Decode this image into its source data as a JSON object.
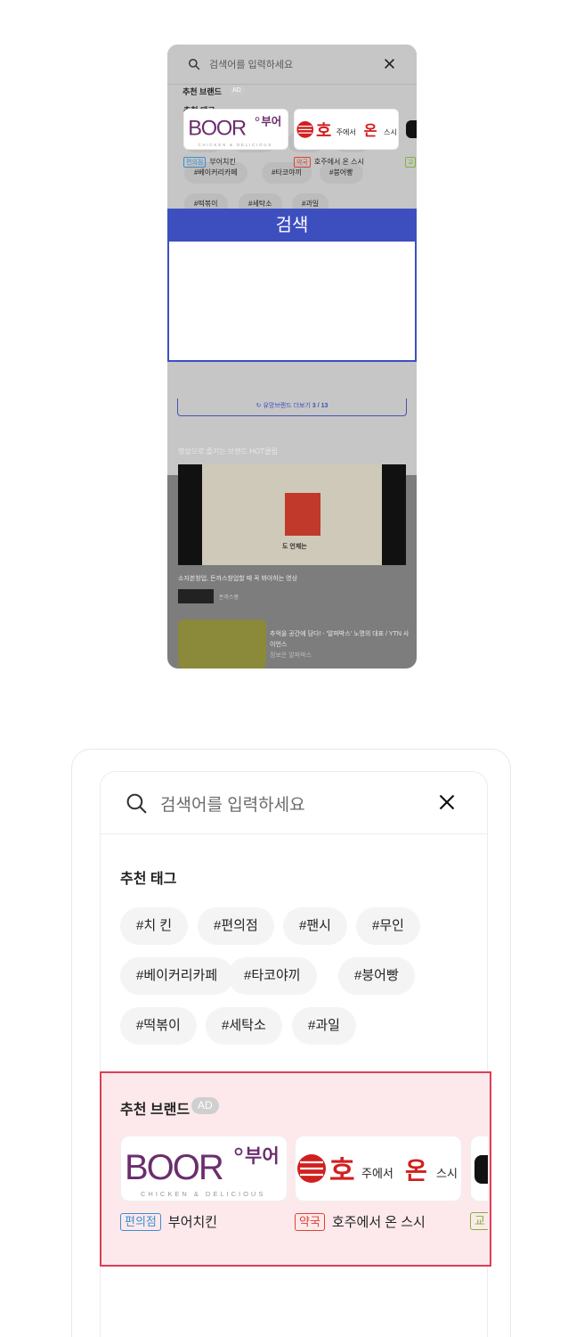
{
  "search": {
    "placeholder": "검색어를 입력하세요"
  },
  "tags": {
    "title": "추천 태그",
    "items": [
      "#치 킨",
      "#편의점",
      "#팬시",
      "#무인",
      "#베이커리카페",
      "#타코야끼",
      "#붕어빵",
      "#떡볶이",
      "#세탁소",
      "#과일"
    ]
  },
  "overlay": {
    "search_button": "검색"
  },
  "brands": {
    "title": "추천 브랜드",
    "ad_badge": "AD",
    "items": [
      {
        "category": "편의점",
        "name": "부어치킨",
        "logo_text": "BOOR",
        "logo_sub": "CHICKEN & DELICIOUS",
        "logo_extra": "부어",
        "category_color": "#3a8fd0"
      },
      {
        "category": "약국",
        "name": "호주에서 온 스시",
        "logo_text": "호주에서 온스시",
        "category_color": "#e0422c"
      },
      {
        "category": "교",
        "name": "",
        "category_color": "#7db33a"
      }
    ]
  },
  "more_brands": {
    "label": "유망브랜드 더보기",
    "page": "3 / 13"
  },
  "videos": {
    "section_title": "영상으로 즐기는 브랜드 HOT클립",
    "main_caption": "도 언제는",
    "main_desc": "소자본창업, 돈까스창업할 때 꼭 봐야하는 영상",
    "channel_name": "돈까스짱",
    "second_desc": "추억을 공간에 담다! - '알파박스' 노명의 대표 / YTN 사이언스",
    "second_channel": "정보은 알파박스"
  },
  "colors": {
    "accent_blue": "#3d4fbf",
    "highlight_red": "#de3c56",
    "highlight_bg": "#fde9ec"
  }
}
